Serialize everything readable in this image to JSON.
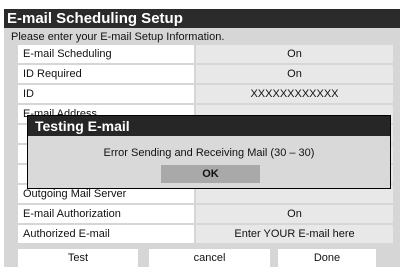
{
  "window": {
    "title": "E-mail Scheduling Setup"
  },
  "instruction": "Please enter your E-mail Setup Information.",
  "rows": [
    {
      "label": "E-mail Scheduling",
      "value": "On"
    },
    {
      "label": "ID Required",
      "value": "On"
    },
    {
      "label": "ID",
      "value": "XXXXXXXXXXXX"
    },
    {
      "label": "E-mail Address",
      "value": ""
    },
    {
      "label": "",
      "value": ""
    },
    {
      "label": "",
      "value": ""
    },
    {
      "label": "",
      "value": ""
    },
    {
      "label": "Outgoing Mail Server",
      "value": ""
    },
    {
      "label": "E-mail Authorization",
      "value": "On"
    },
    {
      "label": "Authorized E-mail",
      "value": "Enter YOUR E-mail here"
    }
  ],
  "buttons": {
    "test": "Test",
    "cancel": "cancel",
    "done": "Done"
  },
  "dialog": {
    "title": "Testing E-mail",
    "message": "Error Sending and Receiving Mail (30 – 30)",
    "ok_label": "OK"
  }
}
